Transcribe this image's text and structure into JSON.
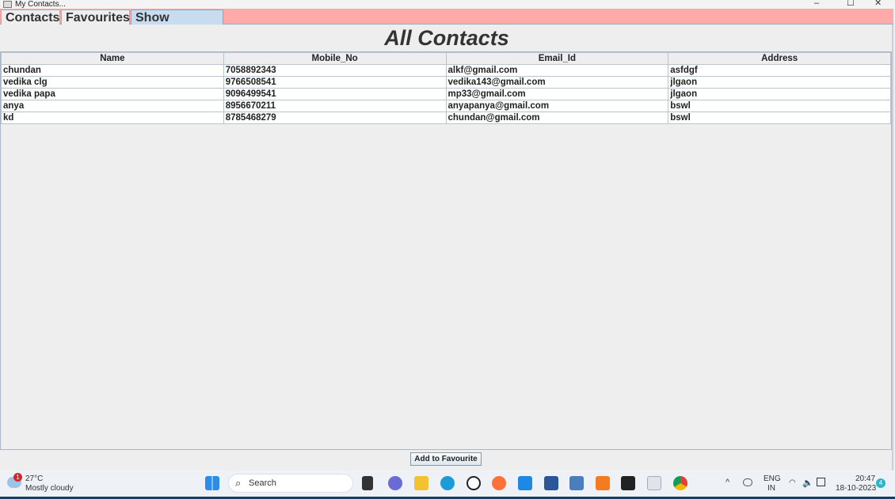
{
  "window": {
    "title": "My Contacts...",
    "minimize": "–",
    "maximize": "☐",
    "close": "✕"
  },
  "tabs": [
    {
      "label": "Contacts"
    },
    {
      "label": "Favourites"
    },
    {
      "label": "Show Contacts",
      "selected": true
    }
  ],
  "heading": "All Contacts",
  "table": {
    "columns": [
      "Name",
      "Mobile_No",
      "Email_Id",
      "Address"
    ],
    "rows": [
      [
        "chundan",
        "7058892343",
        "alkf@gmail.com",
        "asfdgf"
      ],
      [
        "vedika clg",
        "9766508541",
        "vedika143@gmail.com",
        "jlgaon"
      ],
      [
        "vedika papa",
        "9096499541",
        "mp33@gmail.com",
        "jlgaon"
      ],
      [
        "anya",
        "8956670211",
        "anyapanya@gmail.com",
        "bswl"
      ],
      [
        "kd",
        "8785468279",
        "chundan@gmail.com",
        "bswl"
      ]
    ]
  },
  "add_favourite_label": "Add to Favourite",
  "taskbar": {
    "weather_temp": "27°C",
    "weather_desc": "Mostly cloudy",
    "weather_badge": "1",
    "search_placeholder": "Search",
    "lang": "ENG",
    "region": "IN",
    "time": "20:47",
    "date": "18-10-2023",
    "notif_count": "4",
    "tray_chevron": "^"
  },
  "colors": {
    "tabbar": "#ffaaaa",
    "selected_tab": "#c8dcf0"
  }
}
